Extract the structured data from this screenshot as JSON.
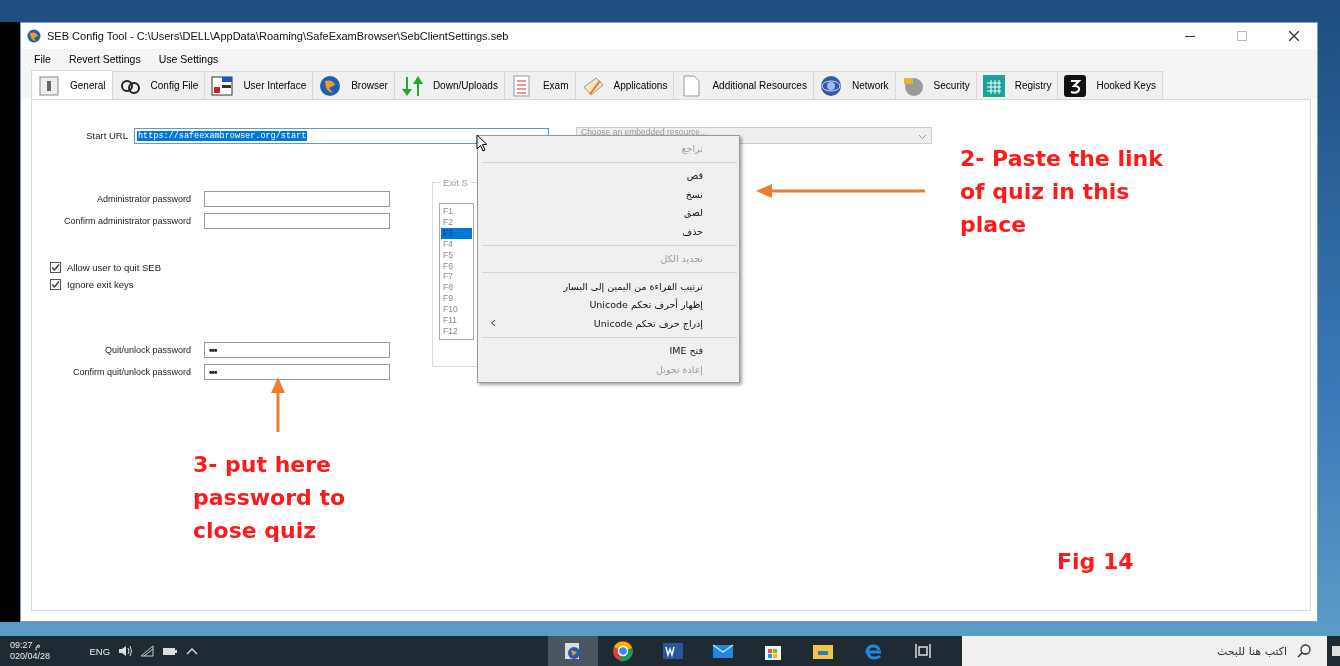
{
  "window": {
    "title": "SEB Config Tool - C:\\Users\\DELL\\AppData\\Roaming\\SafeExamBrowser\\SebClientSettings.seb"
  },
  "menu": [
    "File",
    "Revert Settings",
    "Use Settings"
  ],
  "tabs": [
    {
      "label": "General",
      "selected": true
    },
    {
      "label": "Config File",
      "selected": false
    },
    {
      "label": "User Interface",
      "selected": false
    },
    {
      "label": "Browser",
      "selected": false
    },
    {
      "label": "Down/Uploads",
      "selected": false
    },
    {
      "label": "Exam",
      "selected": false
    },
    {
      "label": "Applications",
      "selected": false
    },
    {
      "label": "Additional Resources",
      "selected": false
    },
    {
      "label": "Network",
      "selected": false
    },
    {
      "label": "Security",
      "selected": false
    },
    {
      "label": "Registry",
      "selected": false
    },
    {
      "label": "Hooked Keys",
      "selected": false
    }
  ],
  "general": {
    "start_url": {
      "label": "Start URL",
      "value": "https://safeexambrowser.org/start"
    },
    "embedded_resource": {
      "placeholder": "Choose an embedded resource..."
    },
    "admin_passwords": [
      {
        "label": "Administrator password"
      },
      {
        "label": "Confirm administrator password"
      }
    ],
    "checkboxes": [
      {
        "label": "Allow user to quit SEB",
        "checked": true
      },
      {
        "label": "Ignore exit keys",
        "checked": true
      }
    ],
    "quit_passwords": [
      {
        "label": "Quit/unlock password",
        "value": "•••"
      },
      {
        "label": "Confirm quit/unlock password",
        "value": "•••"
      }
    ],
    "exit_sequence": {
      "title": "Exit S",
      "keys": [
        {
          "label": "F1",
          "selected": false
        },
        {
          "label": "F2",
          "selected": false
        },
        {
          "label": "F3",
          "selected": true
        },
        {
          "label": "F4",
          "selected": false
        },
        {
          "label": "F5",
          "selected": false
        },
        {
          "label": "F6",
          "selected": false
        },
        {
          "label": "F7",
          "selected": false
        },
        {
          "label": "F8",
          "selected": false
        },
        {
          "label": "F9",
          "selected": false
        },
        {
          "label": "F10",
          "selected": false
        },
        {
          "label": "F11",
          "selected": false
        },
        {
          "label": "F12",
          "selected": false
        }
      ]
    }
  },
  "context_menu": [
    {
      "kind": "item",
      "label": "تراجع",
      "disabled": true,
      "submenu": false
    },
    {
      "kind": "separator"
    },
    {
      "kind": "item",
      "label": "قص",
      "disabled": false,
      "submenu": false
    },
    {
      "kind": "item",
      "label": "نسخ",
      "disabled": false,
      "submenu": false
    },
    {
      "kind": "item",
      "label": "لصق",
      "disabled": false,
      "submenu": false
    },
    {
      "kind": "item",
      "label": "حذف",
      "disabled": false,
      "submenu": false
    },
    {
      "kind": "separator"
    },
    {
      "kind": "item",
      "label": "تحديد الكل",
      "disabled": true,
      "submenu": false
    },
    {
      "kind": "separator"
    },
    {
      "kind": "item",
      "label": "ترتيب القراءة من اليمين إلى اليسار",
      "disabled": false,
      "submenu": false
    },
    {
      "kind": "item",
      "label": "إظهار أحرف تحكم Unicode",
      "disabled": false,
      "submenu": false
    },
    {
      "kind": "item",
      "label": "إدراج حرف تحكم Unicode",
      "disabled": false,
      "submenu": true
    },
    {
      "kind": "separator"
    },
    {
      "kind": "item",
      "label": "فتح IME",
      "disabled": false,
      "submenu": false
    },
    {
      "kind": "item",
      "label": "إعادة تحويل",
      "disabled": true,
      "submenu": false
    }
  ],
  "annotations": [
    {
      "text": "2- Paste the link of quiz in this place"
    },
    {
      "text": "3- put here password to close quiz"
    },
    {
      "text": "Fig 14"
    }
  ],
  "taskbar": {
    "time": "09:27 م",
    "date": "020/04/28",
    "language": "ENG",
    "apps": [
      {
        "selected": true
      },
      {
        "selected": false
      },
      {
        "selected": false
      },
      {
        "selected": false
      },
      {
        "selected": false
      },
      {
        "selected": false
      },
      {
        "selected": false
      },
      {
        "selected": false
      }
    ],
    "search": {
      "placeholder": "اكتب هنا للبحث"
    }
  }
}
